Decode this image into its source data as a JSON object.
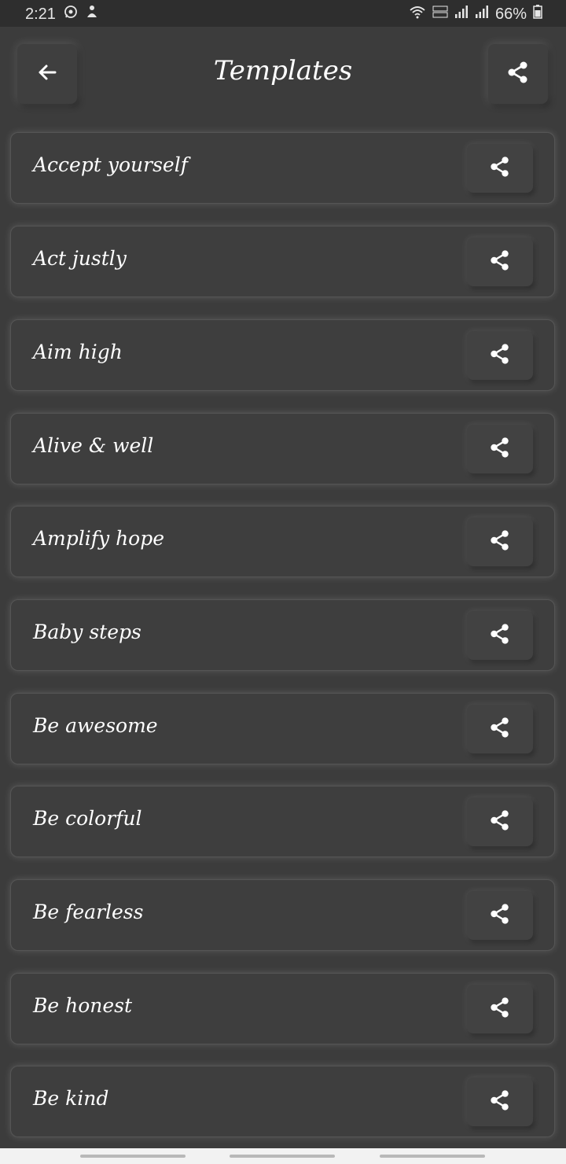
{
  "status_bar": {
    "time": "2:21",
    "battery": "66%",
    "left_icons": [
      "whatsapp-icon",
      "notification-icon"
    ],
    "right_icons": [
      "wifi-icon",
      "volte-icon",
      "signal-icon",
      "signal-icon",
      "battery-icon"
    ]
  },
  "header": {
    "title": "Templates",
    "back_icon": "arrow-left-icon",
    "share_icon": "share-icon"
  },
  "templates": [
    {
      "label": "Accept yourself"
    },
    {
      "label": "Act justly"
    },
    {
      "label": "Aim high"
    },
    {
      "label": "Alive & well"
    },
    {
      "label": "Amplify hope"
    },
    {
      "label": "Baby steps"
    },
    {
      "label": "Be awesome"
    },
    {
      "label": "Be colorful"
    },
    {
      "label": "Be fearless"
    },
    {
      "label": "Be honest"
    },
    {
      "label": "Be kind"
    }
  ],
  "colors": {
    "background": "#3c3c3c",
    "card": "#3e3e3e",
    "text": "#ffffff",
    "status_bar": "#2e2e2e",
    "nav_bar": "#f2f2f2"
  }
}
